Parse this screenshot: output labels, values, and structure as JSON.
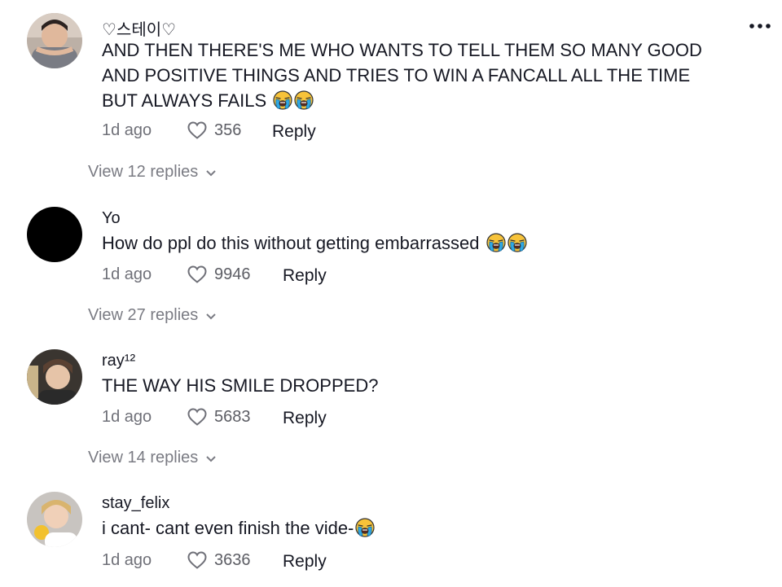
{
  "comments": [
    {
      "username": "♡스테이♡",
      "text": "AND THEN THERE'S ME WHO WANTS TO TELL THEM SO MANY GOOD AND POSITIVE THINGS AND TRIES TO WIN A FANCALL ALL THE TIME BUT ALWAYS FAILS",
      "emojis": [
        "loudly-crying-face",
        "loudly-crying-face"
      ],
      "time": "1d ago",
      "likes": "356",
      "reply_label": "Reply",
      "view_replies": "View 12 replies"
    },
    {
      "username": "Yo",
      "text": "How do ppl do this without getting embarrassed",
      "emojis": [
        "loudly-crying-face",
        "loudly-crying-face"
      ],
      "time": "1d ago",
      "likes": "9946",
      "reply_label": "Reply",
      "view_replies": "View 27 replies"
    },
    {
      "username": "ray¹²",
      "text": "THE WAY HIS SMILE DROPPED?",
      "emojis": [],
      "time": "1d ago",
      "likes": "5683",
      "reply_label": "Reply",
      "view_replies": "View 14 replies"
    },
    {
      "username": "stay_felix",
      "text": "i cant- cant even finish the vide-",
      "emojis": [
        "loudly-crying-face"
      ],
      "time": "1d ago",
      "likes": "3636",
      "reply_label": "Reply"
    }
  ],
  "icons": {
    "like": "heart-outline-icon",
    "more": "more-dots-icon",
    "expand": "chevron-down-icon"
  },
  "colors": {
    "text_primary": "#161823",
    "text_secondary": "#6f7078",
    "emoji_face": "#f7c33a",
    "emoji_tears": "#2fa9e6"
  }
}
